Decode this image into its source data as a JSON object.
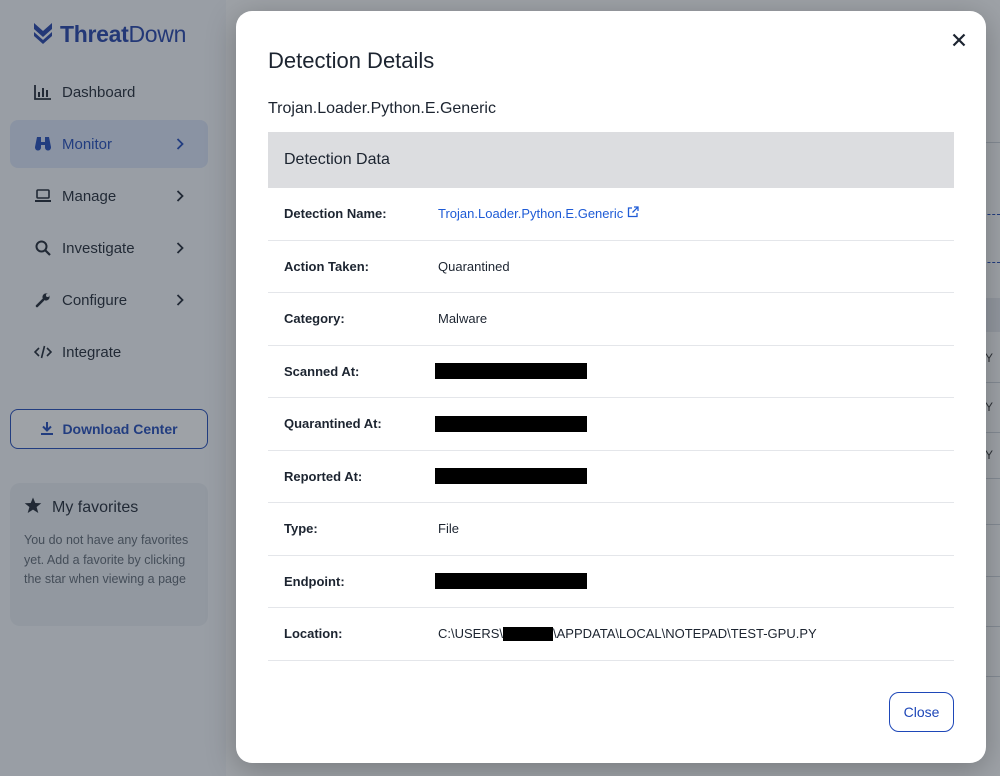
{
  "brand": {
    "name_bold": "Threat",
    "name_rest": "Down"
  },
  "sidebar": {
    "items": [
      {
        "label": "Dashboard",
        "icon": "bar-chart-icon",
        "chevron": false,
        "active": false
      },
      {
        "label": "Monitor",
        "icon": "binoculars-icon",
        "chevron": true,
        "active": true
      },
      {
        "label": "Manage",
        "icon": "laptop-icon",
        "chevron": true,
        "active": false
      },
      {
        "label": "Investigate",
        "icon": "search-icon",
        "chevron": true,
        "active": false
      },
      {
        "label": "Configure",
        "icon": "wrench-icon",
        "chevron": true,
        "active": false
      },
      {
        "label": "Integrate",
        "icon": "code-icon",
        "chevron": false,
        "active": false
      }
    ],
    "download_center": "Download Center",
    "favorites": {
      "title": "My favorites",
      "text": "You do not have any favorites yet. Add a favorite by clicking the star when viewing a page"
    }
  },
  "background": {
    "row_markers": [
      "Y",
      "Y",
      "Y"
    ]
  },
  "modal": {
    "title": "Detection Details",
    "subtitle": "Trojan.Loader.Python.E.Generic",
    "section": "Detection Data",
    "rows": {
      "detection_name": {
        "label": "Detection Name:",
        "value": "Trojan.Loader.Python.E.Generic"
      },
      "action_taken": {
        "label": "Action Taken:",
        "value": "Quarantined"
      },
      "category": {
        "label": "Category:",
        "value": "Malware"
      },
      "scanned_at": {
        "label": "Scanned At:"
      },
      "quarantined_at": {
        "label": "Quarantined At:"
      },
      "reported_at": {
        "label": "Reported At:"
      },
      "type": {
        "label": "Type:",
        "value": "File"
      },
      "endpoint": {
        "label": "Endpoint:"
      },
      "location": {
        "label": "Location:",
        "value_prefix": "C:\\USERS\\",
        "value_suffix": "\\APPDATA\\LOCAL\\NOTEPAD\\TEST-GPU.PY"
      }
    },
    "close_label": "Close"
  },
  "colors": {
    "accent": "#1e47b8",
    "link": "#1e5bd6",
    "section_bg": "#dcdde0"
  }
}
